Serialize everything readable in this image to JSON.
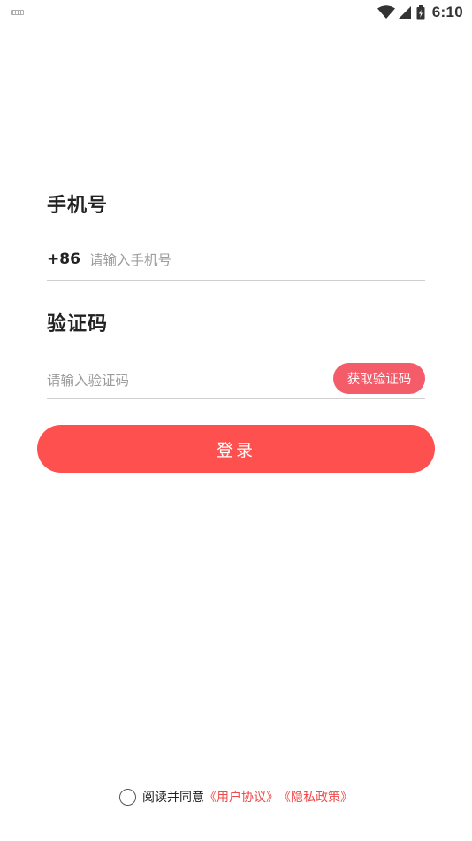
{
  "status_bar": {
    "time": "6:10",
    "icons": [
      "keyboard-icon",
      "wifi-icon",
      "signal-icon",
      "battery-icon"
    ]
  },
  "form": {
    "phone_label": "手机号",
    "phone_prefix": "+86",
    "phone_placeholder": "请输入手机号",
    "phone_value": "",
    "code_label": "验证码",
    "code_placeholder": "请输入验证码",
    "code_value": "",
    "get_code_button": "获取验证码",
    "login_button": "登录"
  },
  "agreement": {
    "text": "阅读并同意",
    "user_agreement_link": "《用户协议》",
    "privacy_policy_link": "《隐私政策》",
    "checked": false
  },
  "colors": {
    "accent": "#ff5050",
    "code_button": "#f45c6a",
    "link": "#f04b4b",
    "placeholder": "#9d9d9d"
  }
}
